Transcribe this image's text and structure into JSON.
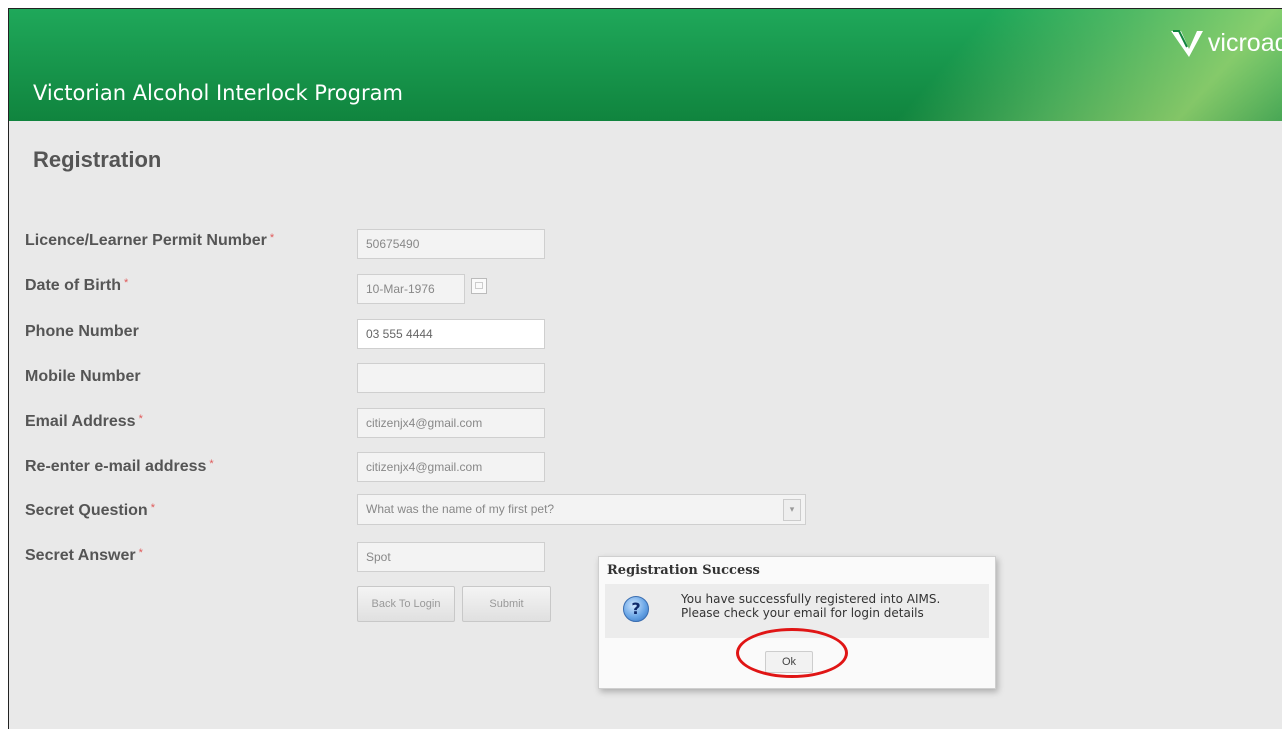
{
  "header": {
    "title": "Victorian Alcohol Interlock Program",
    "logo_text": "vicroads",
    "logo_icon": "vicroads-v-logo",
    "brand_color": "#12954a"
  },
  "page": {
    "title": "Registration"
  },
  "form": {
    "licence": {
      "label": "Licence/Learner Permit Number",
      "value": "50675490"
    },
    "dob": {
      "label": "Date of Birth",
      "value": "10-Mar-1976"
    },
    "phone": {
      "label": "Phone Number",
      "value": "03 555 4444"
    },
    "mobile": {
      "label": "Mobile Number",
      "value": ""
    },
    "email": {
      "label": "Email Address",
      "value": "citizenjx4@gmail.com"
    },
    "email_confirm": {
      "label": "Re-enter e-mail address",
      "value": "citizenjx4@gmail.com"
    },
    "secret_question": {
      "label": "Secret Question",
      "value": "What was the name of my first pet?"
    },
    "secret_answer": {
      "label": "Secret Answer",
      "value": "Spot"
    },
    "required_marker": "*",
    "back_button": "Back To Login",
    "submit_button": "Submit"
  },
  "dialog": {
    "title": "Registration Success",
    "message_line1": "You have successfully registered into AIMS.",
    "message_line2": "Please check your email for login details",
    "ok_button": "Ok",
    "icon": "question-icon",
    "highlight_color": "#e01515"
  }
}
